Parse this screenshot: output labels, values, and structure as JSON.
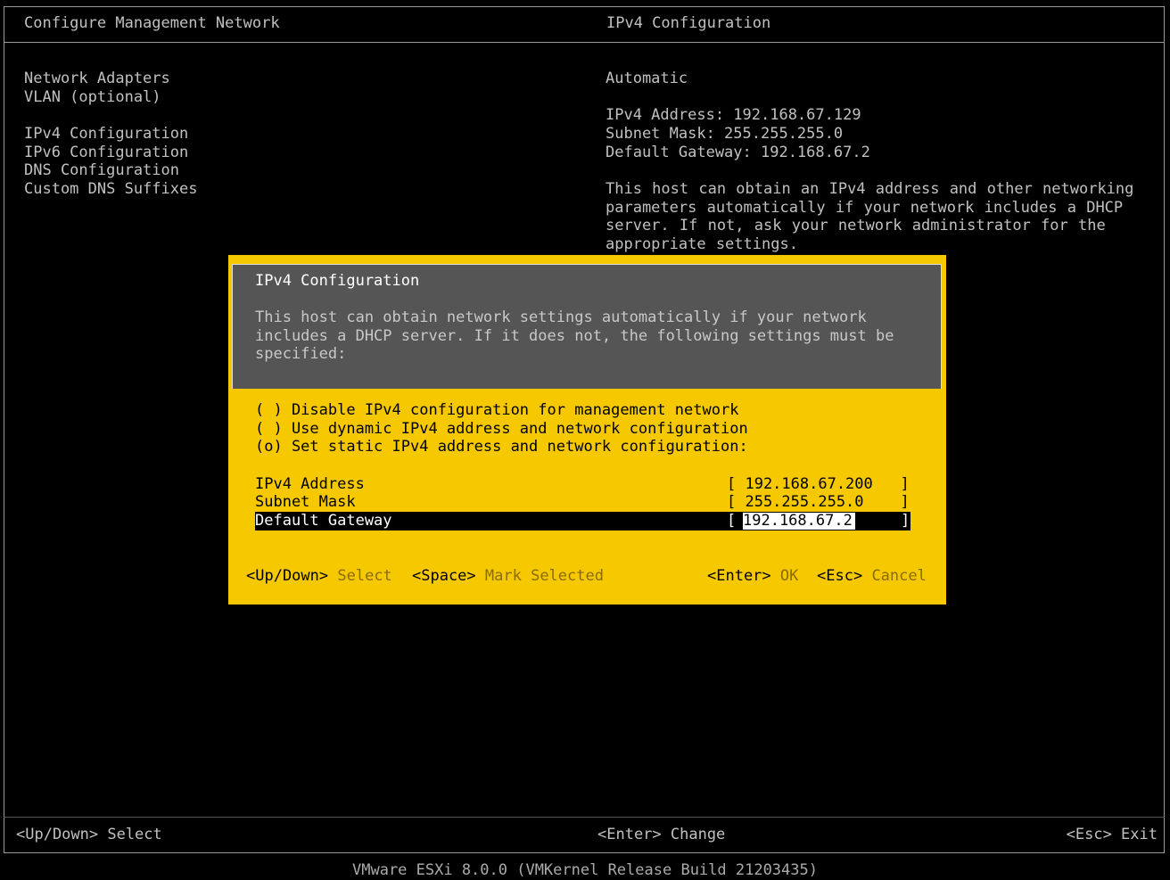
{
  "header": {
    "left_title": "Configure Management Network",
    "right_title": "IPv4 Configuration"
  },
  "menu": {
    "items": [
      {
        "label": "Network Adapters"
      },
      {
        "label": "VLAN (optional)"
      },
      {
        "label": "IPv4 Configuration"
      },
      {
        "label": "IPv6 Configuration"
      },
      {
        "label": "DNS Configuration"
      },
      {
        "label": "Custom DNS Suffixes"
      }
    ]
  },
  "info": {
    "mode": "Automatic",
    "ipv4_address": "IPv4 Address: 192.168.67.129",
    "subnet_mask": "Subnet Mask: 255.255.255.0",
    "default_gateway": "Default Gateway: 192.168.67.2",
    "description": "This host can obtain an IPv4 address and other networking parameters automatically if your network includes a DHCP server. If not, ask your network administrator for the appropriate settings."
  },
  "dialog": {
    "title": "IPv4 Configuration",
    "description": "This host can obtain network settings automatically if your network includes a DHCP server. If it does not, the following settings must be specified:",
    "options": [
      {
        "text": "( ) Disable IPv4 configuration for management network",
        "selected": false
      },
      {
        "text": "( ) Use dynamic IPv4 address and network configuration",
        "selected": false
      },
      {
        "text": "(o) Set static IPv4 address and network configuration:",
        "selected": true
      }
    ],
    "fields": {
      "ipv4_label": "IPv4 Address",
      "ipv4_value": "[ 192.168.67.200   ]",
      "mask_label": "Subnet Mask",
      "mask_value": "[ 255.255.255.0    ]",
      "gateway_label": "Default Gateway",
      "gateway_bracket_left": "[",
      "gateway_input": "192.168.67.2",
      "gateway_bracket_right": "]"
    },
    "hints": {
      "updown_key": "<Up/Down>",
      "updown_action": "Select",
      "space_key": "<Space>",
      "space_action": "Mark Selected",
      "enter_key": "<Enter>",
      "enter_action": "OK",
      "esc_key": "<Esc>",
      "esc_action": "Cancel"
    }
  },
  "footer": {
    "left": "<Up/Down> Select",
    "center": "<Enter> Change",
    "right": "<Esc> Exit",
    "version": "VMware ESXi 8.0.0 (VMKernel Release Build 21203435)"
  },
  "colors": {
    "background": "#000000",
    "dialog_accent": "#f5c800",
    "dialog_header": "#555555"
  }
}
